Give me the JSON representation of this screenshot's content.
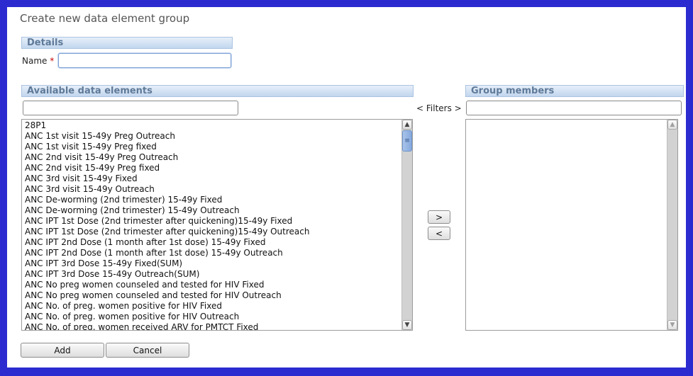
{
  "window": {
    "title": "Create new data element group"
  },
  "details": {
    "header": "Details",
    "name_label": "Name",
    "required_mark": "*",
    "name_value": ""
  },
  "available": {
    "header": "Available data elements",
    "filter_value": "",
    "items": [
      "28P1",
      "ANC 1st visit 15-49y Preg Outreach",
      "ANC 1st visit 15-49y Preg fixed",
      "ANC 2nd visit 15-49y Preg Outreach",
      "ANC 2nd visit 15-49y Preg fixed",
      "ANC 3rd visit 15-49y Fixed",
      "ANC 3rd visit 15-49y Outreach",
      "ANC De-worming (2nd trimester) 15-49y Fixed",
      "ANC De-worming (2nd trimester) 15-49y Outreach",
      "ANC IPT 1st Dose (2nd trimester after quickening)15-49y Fixed",
      "ANC IPT 1st Dose (2nd trimester after quickening)15-49y Outreach",
      "ANC IPT 2nd Dose (1 month after 1st dose) 15-49y Fixed",
      "ANC IPT 2nd Dose (1 month after 1st dose) 15-49y Outreach",
      "ANC IPT 3rd Dose 15-49y Fixed(SUM)",
      "ANC IPT 3rd Dose 15-49y Outreach(SUM)",
      "ANC No preg women counseled and tested for HIV Fixed",
      "ANC No preg women counseled and tested for HIV Outreach",
      "ANC No. of preg. women positive for HIV Fixed",
      "ANC No. of preg. women positive for HIV Outreach",
      "ANC No. of preg. women received ARV for PMTCT Fixed"
    ]
  },
  "filters_label": "< Filters >",
  "move": {
    "add_label": ">",
    "remove_label": "<"
  },
  "members": {
    "header": "Group members",
    "filter_value": "",
    "items": []
  },
  "scroll_icons": {
    "up": "▲",
    "down": "▼",
    "grip": "≡"
  },
  "footer": {
    "add_label": "Add",
    "cancel_label": "Cancel"
  }
}
